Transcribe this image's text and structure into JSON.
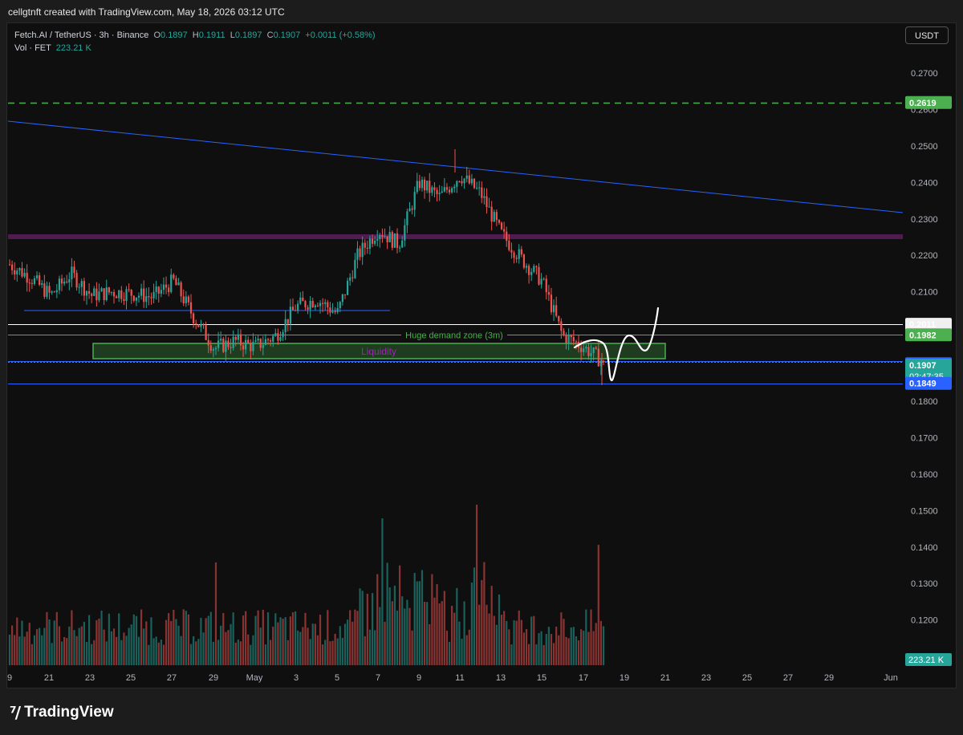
{
  "watermark": "cellgtnft created with TradingView.com, May 18, 2026 03:12 UTC",
  "brand": "TradingView",
  "currency_button": "USDT",
  "legend": {
    "symbol": "Fetch.AI / TetherUS · 3h · Binance",
    "o_label": "O",
    "o_value": "0.1897",
    "h_label": "H",
    "h_value": "0.1911",
    "l_label": "L",
    "l_value": "0.1897",
    "c_label": "C",
    "c_value": "0.1907",
    "change": "+0.0011 (+0.58%)",
    "vol_label": "Vol · FET",
    "vol_value": "223.21 K"
  },
  "colors": {
    "up": "#26a69a",
    "down": "#ef5350",
    "green_line": "#4caf50",
    "blue": "#2962ff",
    "purple": "#9c27b0"
  },
  "chart_data": {
    "type": "candlestick",
    "symbol": "FETUSDT",
    "interval": "3h",
    "ylim": [
      0.1,
      0.28
    ],
    "y_ticks": [
      "0.2700",
      "0.2600",
      "0.2500",
      "0.2400",
      "0.2300",
      "0.2200",
      "0.2100",
      "0.2000",
      "0.1900",
      "0.1800",
      "0.1700",
      "0.1600",
      "0.1500",
      "0.1400",
      "0.1300",
      "0.1200"
    ],
    "x_ticks": [
      "9",
      "21",
      "23",
      "25",
      "27",
      "29",
      "May",
      "3",
      "5",
      "7",
      "9",
      "11",
      "13",
      "15",
      "17",
      "19",
      "21",
      "23",
      "25",
      "27",
      "29",
      "Jun"
    ],
    "price_path": [
      [
        "Apr 19",
        0.2175
      ],
      [
        "Apr 20",
        0.214
      ],
      [
        "Apr 21",
        0.209
      ],
      [
        "Apr 22",
        0.215
      ],
      [
        "Apr 23",
        0.209
      ],
      [
        "Apr 24",
        0.21
      ],
      [
        "Apr 25",
        0.2095
      ],
      [
        "Apr 26",
        0.2085
      ],
      [
        "Apr 27",
        0.213
      ],
      [
        "Apr 28",
        0.203
      ],
      [
        "Apr 29",
        0.1945
      ],
      [
        "Apr 30",
        0.1965
      ],
      [
        "May 1",
        0.195
      ],
      [
        "May 2",
        0.198
      ],
      [
        "May 3",
        0.206
      ],
      [
        "May 4",
        0.208
      ],
      [
        "May 5",
        0.204
      ],
      [
        "May 6",
        0.22
      ],
      [
        "May 7",
        0.227
      ],
      [
        "May 8",
        0.223
      ],
      [
        "May 9",
        0.24
      ],
      [
        "May 10",
        0.236
      ],
      [
        "May 11",
        0.242
      ],
      [
        "May 12",
        0.237
      ],
      [
        "May 13",
        0.226
      ],
      [
        "May 14",
        0.219
      ],
      [
        "May 15",
        0.213
      ],
      [
        "May 16",
        0.198
      ],
      [
        "May 17",
        0.195
      ],
      [
        "May 18",
        0.1907
      ]
    ],
    "levels": [
      {
        "label": "0.2619",
        "price": 0.2619,
        "color": "#4caf50",
        "style": "dashed"
      },
      {
        "label": "0.2011",
        "price": 0.2011,
        "color": "#ffffff",
        "style": "solid"
      },
      {
        "label": "0.1982",
        "price": 0.1982,
        "color": "#4caf50",
        "style": "solid"
      },
      {
        "label": "0.1910",
        "price": 0.191,
        "color": "#2962ff",
        "style": "solid"
      },
      {
        "label": "0.1907",
        "price": 0.1907,
        "color": "#26a69a",
        "style": "dotted",
        "countdown": "02:47:35"
      },
      {
        "label": "0.1849",
        "price": 0.1849,
        "color": "#2962ff",
        "style": "solid"
      }
    ],
    "annotations": {
      "demand_zone": "Huge demand zone (3m)",
      "liquidity": "Liquidity"
    },
    "volume_last": "223.21 K"
  }
}
